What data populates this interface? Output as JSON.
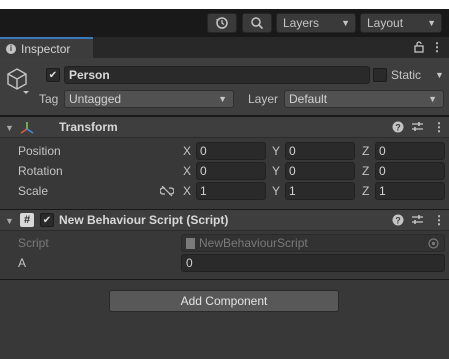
{
  "toolbar": {
    "layers_label": "Layers",
    "layout_label": "Layout"
  },
  "tab": {
    "title": "Inspector"
  },
  "object": {
    "name": "Person",
    "active": true,
    "static_label": "Static",
    "tag_label": "Tag",
    "tag_value": "Untagged",
    "layer_label": "Layer",
    "layer_value": "Default"
  },
  "transform": {
    "title": "Transform",
    "position_label": "Position",
    "rotation_label": "Rotation",
    "scale_label": "Scale",
    "axis_x": "X",
    "axis_y": "Y",
    "axis_z": "Z",
    "position": {
      "x": "0",
      "y": "0",
      "z": "0"
    },
    "rotation": {
      "x": "0",
      "y": "0",
      "z": "0"
    },
    "scale": {
      "x": "1",
      "y": "1",
      "z": "1"
    }
  },
  "script_component": {
    "title": "New Behaviour Script (Script)",
    "hash_glyph": "#",
    "script_label": "Script",
    "script_value": "NewBehaviourScript",
    "a_label": "A",
    "a_value": "0"
  },
  "add_component_label": "Add Component",
  "colors": {
    "background": "#383838",
    "toolbar": "#191919",
    "tab_accent": "#3a79bb",
    "field": "#2a2a2a",
    "button": "#585858"
  },
  "icons": [
    "history-icon",
    "search-icon",
    "lock-icon",
    "kebab-menu-icon",
    "cube-icon",
    "transform-axes-icon",
    "help-icon",
    "presets-icon",
    "unlink-icon",
    "script-file-icon",
    "object-picker-icon"
  ]
}
